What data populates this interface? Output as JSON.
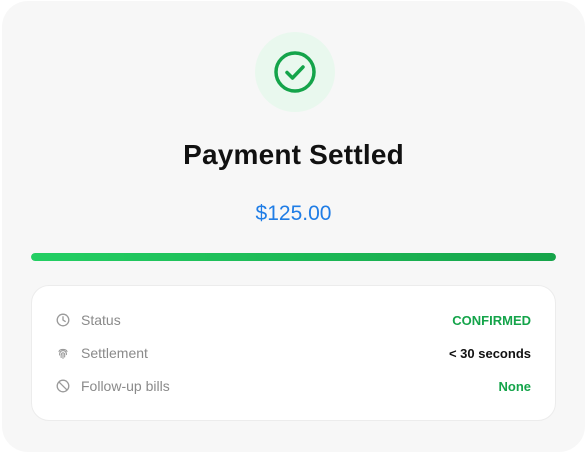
{
  "payment": {
    "title": "Payment Settled",
    "amount": "$125.00",
    "progress_fraction": 1.0
  },
  "details": [
    {
      "icon": "clock-icon",
      "label": "Status",
      "value": "CONFIRMED",
      "value_color": "#14a44a"
    },
    {
      "icon": "fingerprint-icon",
      "label": "Settlement",
      "value": "< 30 seconds",
      "value_color": "#111111"
    },
    {
      "icon": "ban-icon",
      "label": "Follow-up bills",
      "value": "None",
      "value_color": "#14a44a"
    }
  ],
  "colors": {
    "success": "#14a44a",
    "amount": "#1f7de6",
    "card_bg": "#f7f7f7"
  }
}
